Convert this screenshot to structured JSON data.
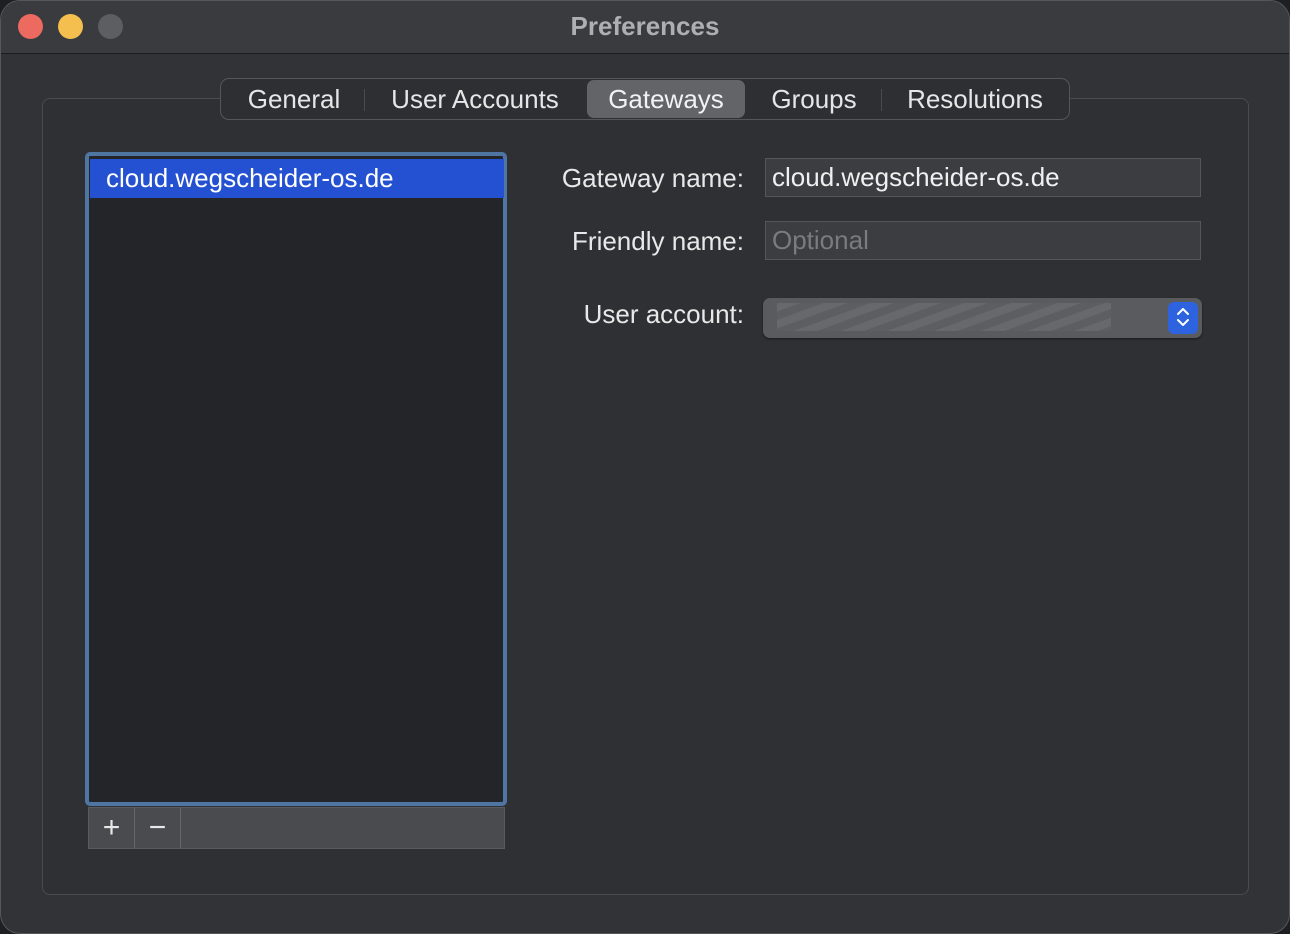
{
  "window": {
    "title": "Preferences"
  },
  "tabs": [
    {
      "label": "General"
    },
    {
      "label": "User Accounts"
    },
    {
      "label": "Gateways",
      "active": true
    },
    {
      "label": "Groups"
    },
    {
      "label": "Resolutions"
    }
  ],
  "gateway_list": {
    "items": [
      "cloud.wegscheider-os.de"
    ],
    "selected_index": 0,
    "add_label": "+",
    "remove_label": "−"
  },
  "form": {
    "gateway_name_label": "Gateway name:",
    "gateway_name_value": "cloud.wegscheider-os.de",
    "friendly_name_label": "Friendly name:",
    "friendly_name_value": "",
    "friendly_name_placeholder": "Optional",
    "user_account_label": "User account:",
    "user_account_value": ""
  },
  "colors": {
    "selection": "#2451d1",
    "focus_ring": "#4f75a3",
    "close": "#ec6a5f",
    "minimize": "#f4bf4f",
    "zoom": "#5d5e61",
    "popup_accent": "#2e63df"
  }
}
